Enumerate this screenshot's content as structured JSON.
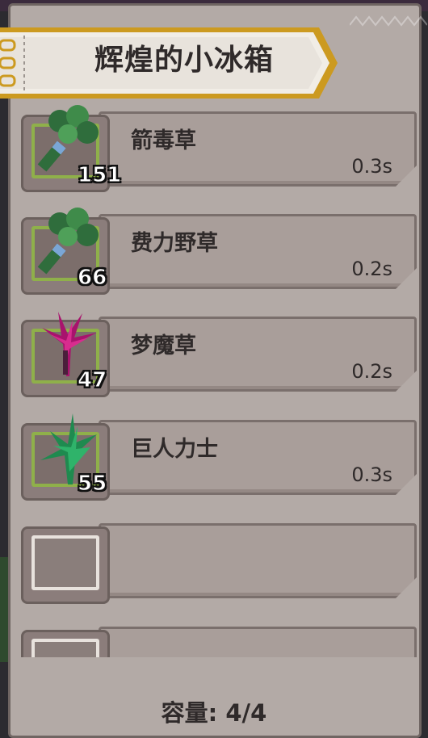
{
  "title": "辉煌的小冰箱",
  "items": [
    {
      "name": "箭毒草",
      "time": "0.3s",
      "count": "151",
      "icon": "herb-leaf-icon"
    },
    {
      "name": "费力野草",
      "time": "0.2s",
      "count": "66",
      "icon": "herb-leaf-icon"
    },
    {
      "name": "梦魔草",
      "time": "0.2s",
      "count": "47",
      "icon": "magenta-plant-icon"
    },
    {
      "name": "巨人力士",
      "time": "0.3s",
      "count": "55",
      "icon": "green-plant-icon"
    }
  ],
  "capacity": "容量: 4/4",
  "colors": {
    "panel": "#b3aaa6",
    "banner_border": "#d6a428",
    "slot_border": "#8fb04a"
  }
}
